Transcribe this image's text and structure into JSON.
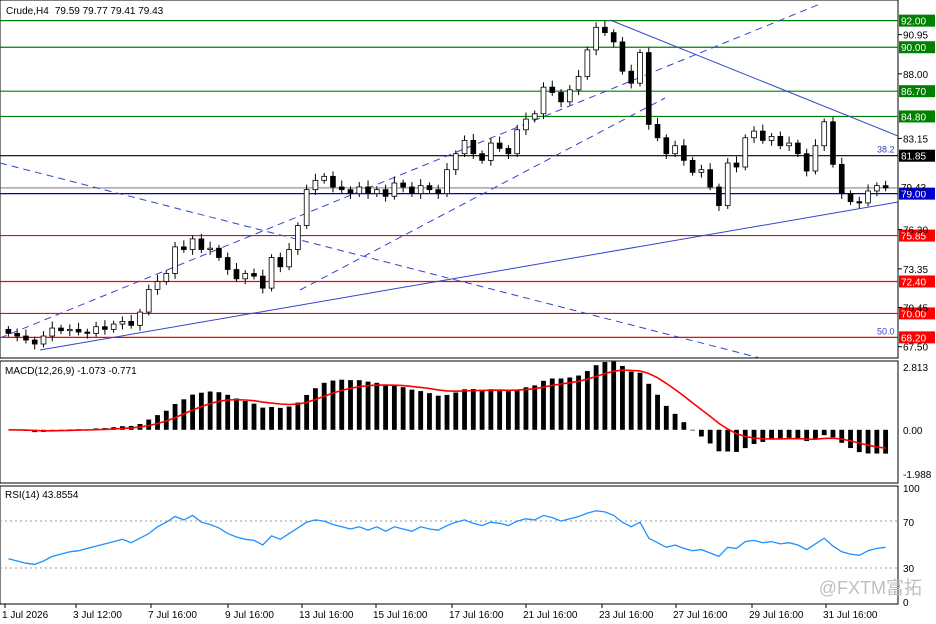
{
  "symbol": "Crude,H4",
  "ohlc": "79.59 79.77 79.41 79.43",
  "watermark": "@FXTM富拓",
  "colors": {
    "bull_body": "#ffffff",
    "bear_body": "#000000",
    "wick": "#000000",
    "green_level": "#008000",
    "red_level": "#ff0000",
    "blue_level": "#0000cc",
    "channel": "#3344cc",
    "macd_line": "#ff0000",
    "macd_hist": "#000000",
    "rsi_line": "#1e90ff"
  },
  "chart_data": [
    {
      "type": "candlestick",
      "ylim": [
        66.8,
        93.4
      ],
      "price_ticks": [
        "92.00",
        "90.95",
        "90.00",
        "88.00",
        "86.70",
        "84.80",
        "83.15",
        "81.85",
        "79.43",
        "79.00",
        "76.30",
        "75.85",
        "73.35",
        "72.40",
        "70.45",
        "70.00",
        "68.20",
        "67.50"
      ],
      "green_levels": [
        {
          "value": 92.0,
          "label": "92.00"
        },
        {
          "value": 90.0,
          "label": "90.00"
        },
        {
          "value": 86.7,
          "label": "86.70"
        },
        {
          "value": 84.8,
          "label": "84.80"
        }
      ],
      "red_levels": [
        {
          "value": 75.85,
          "label": "75.85"
        },
        {
          "value": 72.4,
          "label": "72.40"
        },
        {
          "value": 70.0,
          "label": "70.00"
        },
        {
          "value": 68.2,
          "label": "68.20"
        }
      ],
      "black_levels": [
        {
          "value": 81.85,
          "label": "81.85"
        }
      ],
      "blue_levels": [
        {
          "value": 79.0,
          "label": "79.00"
        }
      ],
      "current_price": {
        "value": 79.43,
        "label": "79.43"
      },
      "fib_labels": [
        {
          "text": "38.2",
          "value": 82.1
        },
        {
          "text": "50.0",
          "value": 68.4
        }
      ],
      "closes": [
        68.5,
        68.3,
        68.0,
        67.7,
        68.3,
        68.9,
        68.7,
        68.8,
        68.6,
        68.5,
        69.0,
        68.8,
        69.2,
        69.4,
        69.1,
        70.1,
        71.8,
        72.4,
        73.0,
        75.0,
        74.8,
        75.6,
        74.8,
        74.9,
        74.2,
        73.3,
        72.6,
        73.0,
        72.8,
        71.9,
        74.2,
        73.5,
        74.8,
        76.6,
        79.3,
        80.0,
        80.3,
        79.5,
        79.3,
        79.0,
        79.5,
        79.0,
        79.3,
        78.8,
        79.8,
        79.5,
        79.0,
        79.6,
        79.3,
        79.0,
        80.8,
        82.0,
        83.0,
        82.0,
        81.5,
        82.8,
        82.4,
        82.0,
        83.8,
        84.6,
        85.0,
        87.0,
        86.6,
        85.9,
        86.8,
        87.8,
        89.8,
        91.5,
        91.1,
        90.4,
        88.2,
        87.3,
        89.6,
        84.2,
        83.2,
        82.0,
        82.6,
        81.5,
        80.6,
        80.8,
        79.5,
        78.1,
        81.3,
        81.0,
        83.2,
        83.7,
        83.0,
        83.3,
        82.6,
        82.8,
        82.0,
        80.7,
        82.6,
        84.4,
        81.2,
        79.0,
        78.4,
        78.3,
        79.2,
        79.6,
        79.43
      ],
      "x_ticks": [
        "1 Jul 2026",
        "3 Jul 12:00",
        "7 Jul 16:00",
        "9 Jul 16:00",
        "13 Jul 16:00",
        "15 Jul 16:00",
        "17 Jul 16:00",
        "21 Jul 16:00",
        "23 Jul 16:00",
        "27 Jul 16:00",
        "29 Jul 16:00",
        "31 Jul 16:00"
      ]
    },
    {
      "type": "bar",
      "indicator": "MACD(12,26,9) -1.073 -0.771",
      "ylim": [
        -2.3,
        3.0
      ],
      "ticks": [
        "2.813",
        "0.00",
        "-1.988"
      ],
      "signal_color": "#ff0000"
    },
    {
      "type": "line",
      "indicator": "RSI(14) 43.8554",
      "ylim": [
        0,
        100
      ],
      "ticks": [
        "100",
        "70",
        "30",
        "0"
      ],
      "values": [
        38,
        36,
        34,
        33,
        36,
        40,
        42,
        44,
        45,
        47,
        49,
        51,
        53,
        55,
        52,
        56,
        60,
        66,
        70,
        75,
        72,
        76,
        70,
        68,
        65,
        60,
        57,
        55,
        54,
        50,
        58,
        55,
        60,
        65,
        70,
        72,
        71,
        68,
        66,
        64,
        66,
        63,
        66,
        62,
        66,
        64,
        62,
        66,
        64,
        63,
        67,
        70,
        72,
        69,
        67,
        70,
        69,
        67,
        71,
        73,
        72,
        76,
        74,
        71,
        73,
        75,
        78,
        80,
        79,
        76,
        70,
        66,
        70,
        56,
        52,
        48,
        50,
        47,
        45,
        46,
        43,
        40,
        48,
        47,
        53,
        54,
        52,
        53,
        51,
        52,
        50,
        46,
        51,
        56,
        49,
        44,
        42,
        41,
        45,
        47,
        48
      ]
    }
  ]
}
